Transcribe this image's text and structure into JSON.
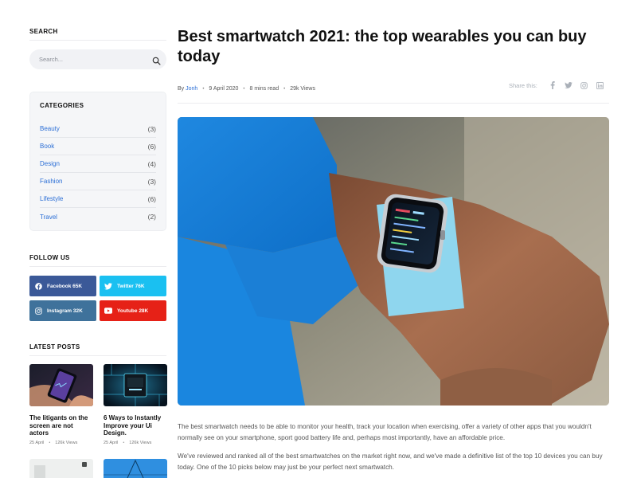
{
  "sidebar": {
    "search": {
      "title": "SEARCH",
      "placeholder": "Search..."
    },
    "categories": {
      "title": "CATEGORIES",
      "items": [
        {
          "name": "Beauty",
          "count": "(3)"
        },
        {
          "name": "Book",
          "count": "(6)"
        },
        {
          "name": "Design",
          "count": "(4)"
        },
        {
          "name": "Fashion",
          "count": "(3)"
        },
        {
          "name": "Lifestyle",
          "count": "(6)"
        },
        {
          "name": "Travel",
          "count": "(2)"
        }
      ]
    },
    "follow": {
      "title": "FOLLOW US",
      "facebook": "Facebook 65K",
      "twitter": "Twitter 76K",
      "instagram": "Instagram 32K",
      "youtube": "Youtube 28K"
    },
    "latest": {
      "title": "LATEST POSTS",
      "posts": [
        {
          "title": "The litigants on the screen are not actors",
          "date": "25 April",
          "views": "126k Views"
        },
        {
          "title": "6 Ways to Instantly Improve your Ui Design.",
          "date": "25 April",
          "views": "126k Views"
        }
      ]
    }
  },
  "article": {
    "title": "Best smartwatch 2021: the top wearables you can buy today",
    "meta": {
      "by": "By",
      "author": "Jonh",
      "date": "9 April 2020",
      "read": "8 mins read",
      "views": "29k Views"
    },
    "share_label": "Share this:",
    "paragraphs": [
      "The best smartwatch needs to be able to monitor your health, track your location when exercising, offer a variety of other apps that you wouldn't normally see on your smartphone, sport good battery life and, perhaps most importantly, have an affordable price.",
      "We've reviewed and ranked all of the best smartwatches on the market right now, and we've made a definitive list of the top 10 devices you can buy today. One of the 10 picks below may just be your perfect next smartwatch."
    ]
  },
  "icons": {
    "search": "search-icon",
    "facebook": "facebook-icon",
    "twitter": "twitter-icon",
    "instagram": "instagram-icon",
    "youtube": "youtube-icon",
    "linkedin": "linkedin-icon"
  },
  "colors": {
    "link": "#2c6fd6",
    "facebook": "#3b5998",
    "twitter": "#1ac0f1",
    "instagram": "#3f729b",
    "youtube": "#e62117"
  }
}
